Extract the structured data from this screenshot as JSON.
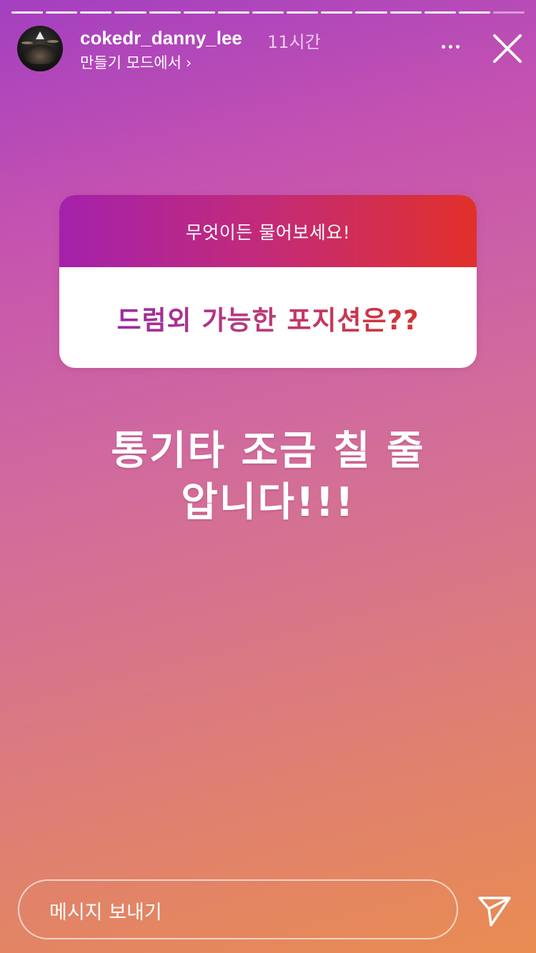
{
  "story": {
    "segments_total": 15,
    "segments_viewed": 14
  },
  "header": {
    "username": "cokedr_danny_lee",
    "time_ago": "11시간",
    "subline": "만들기 모드에서",
    "subline_chevron": "›",
    "avatar_icon": "avatar-drum-kit",
    "more_icon": "more-horizontal-icon",
    "close_icon": "close-icon"
  },
  "sticker": {
    "prompt": "무엇이든 물어보세요!",
    "answer": "드럼외 가능한 포지션은??",
    "gradient_colors": [
      "#a421ab",
      "#c32b78",
      "#e1302a"
    ]
  },
  "reply": {
    "line1": "통기타 조금 칠 줄",
    "line2": "압니다!!!"
  },
  "footer": {
    "message_placeholder": "메시지 보내기",
    "send_icon": "send-paper-plane-icon"
  },
  "colors": {
    "background_top": "#a43fc0",
    "background_bottom": "#e98c52",
    "text": "#ffffff"
  }
}
